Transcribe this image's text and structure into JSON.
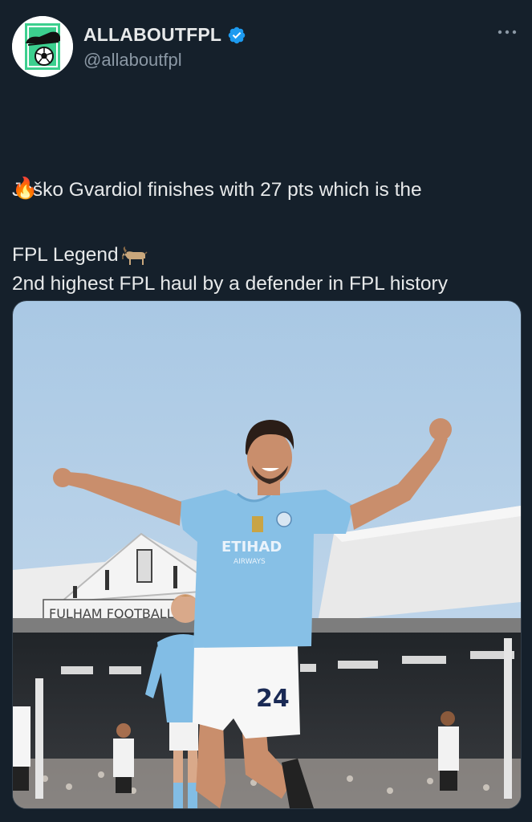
{
  "author": {
    "display_name": "ALLABOUTFPL",
    "handle": "@allaboutfpl",
    "verified": true,
    "avatar_icon": "boot-and-football-logo"
  },
  "tweet": {
    "text_line1": "Joško Gvardiol finishes with 27 pts which is the",
    "text_line2": "2nd highest FPL haul by a defender in FPL history",
    "emoji1": "🔥",
    "text_line3": "FPL Legend",
    "emoji2_icon": "goat-icon"
  },
  "photo": {
    "stadium_sign": "FULHAM FOOTBALL CL",
    "shirt_sponsor": "ETIHAD",
    "shirt_sponsor_sub": "AIRWAYS",
    "shirt_number": "24"
  },
  "colors": {
    "background": "#15202b",
    "text": "#e7e9ea",
    "secondary_text": "#8b98a5",
    "verified_blue": "#1d9bf0",
    "sky": "#9cc2e4",
    "city_blue": "#82bde5",
    "avatar_green": "#3ccf8e"
  }
}
